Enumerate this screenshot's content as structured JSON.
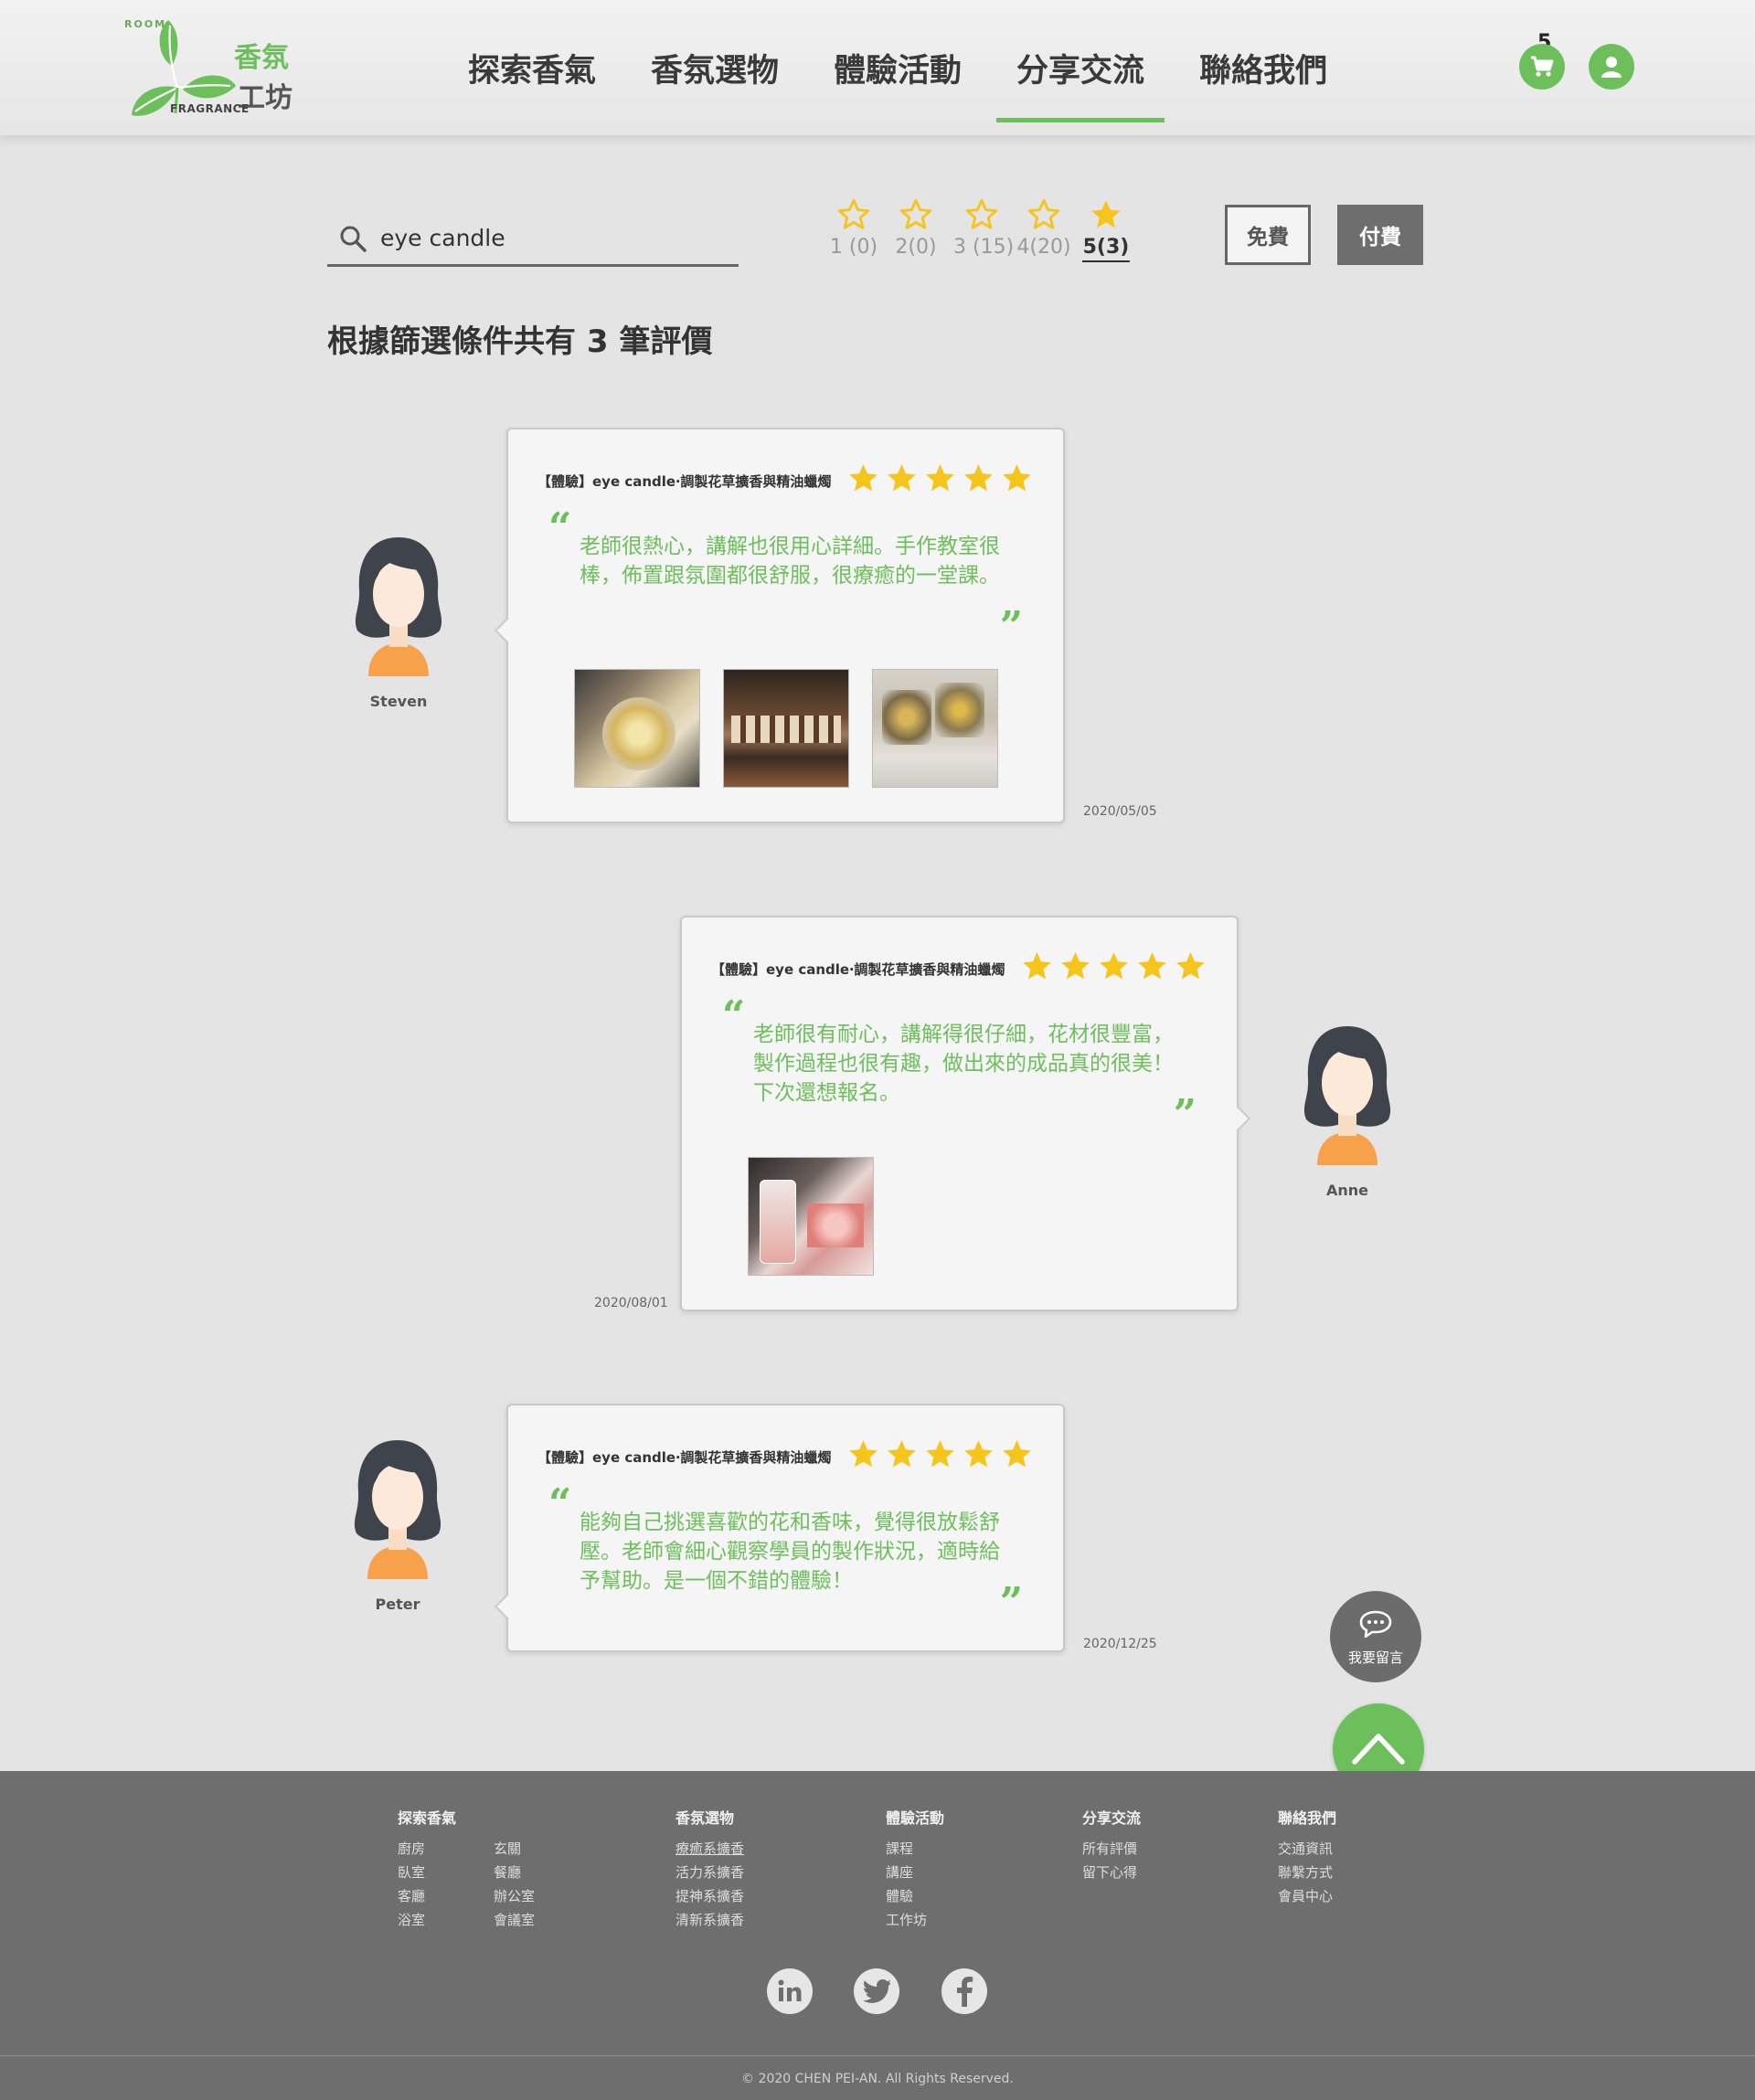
{
  "brand": {
    "room": "ROOM",
    "fragrance": "FRAGRANCE",
    "cn_line1": "香氛",
    "cn_line2": "工坊",
    "green": "#6dbf5c"
  },
  "nav": {
    "items": [
      "探索香氣",
      "香氛選物",
      "體驗活動",
      "分享交流",
      "聯絡我們"
    ],
    "active": "分享交流"
  },
  "header_icons": {
    "cart_icon": "cart-icon",
    "cart_count": "5",
    "user_icon": "user-icon"
  },
  "filter": {
    "search_icon": "search-icon",
    "search_value": "eye candle",
    "star_options": [
      {
        "label": "1 (0)",
        "filled": false
      },
      {
        "label": "2(0)",
        "filled": false
      },
      {
        "label": "3 (15)",
        "filled": false
      },
      {
        "label": "4(20)",
        "filled": false
      },
      {
        "label": "5(3)",
        "filled": true
      }
    ],
    "active_star": "5(3)",
    "free_label": "免費",
    "paid_label": "付費"
  },
  "result_summary": "根據篩選條件共有 3 筆評價",
  "reviews": [
    {
      "title": "【體驗】eye candle‧調製花草擴香與精油蠟燭",
      "rating": 5,
      "text": "老師很熱心，講解也很用心詳細。手作教室很棒，佈置跟氛圍都很舒服，很療癒的一堂課。",
      "name": "Steven",
      "date": "2020/05/05",
      "photos": 3
    },
    {
      "title": "【體驗】eye candle‧調製花草擴香與精油蠟燭",
      "rating": 5,
      "text": "老師很有耐心，講解得很仔細，花材很豐富，製作過程也很有趣，做出來的成品真的很美！下次還想報名。",
      "name": "Anne",
      "date": "2020/08/01",
      "photos": 1
    },
    {
      "title": "【體驗】eye candle‧調製花草擴香與精油蠟燭",
      "rating": 5,
      "text": "能夠自己挑選喜歡的花和香味，覺得很放鬆舒壓。老師會細心觀察學員的製作狀況，適時給予幫助。是一個不錯的體驗！",
      "name": "Peter",
      "date": "2020/12/25",
      "photos": 0
    }
  ],
  "floating": {
    "comment_label": "我要留言",
    "comment_icon": "chat-icon",
    "top_icon": "chevron-up-icon"
  },
  "footer": {
    "col1": {
      "head": "探索香氣",
      "links": [
        "廚房",
        "玄關",
        "臥室",
        "餐廳",
        "客廳",
        "辦公室",
        "浴室",
        "會議室"
      ]
    },
    "col2": {
      "head": "香氛選物",
      "links": [
        "療癒系擴香",
        "活力系擴香",
        "提神系擴香",
        "清新系擴香"
      ]
    },
    "col3": {
      "head": "體驗活動",
      "links": [
        "課程",
        "講座",
        "體驗",
        "工作坊"
      ]
    },
    "col4": {
      "head": "分享交流",
      "links": [
        "所有評價",
        "留下心得"
      ]
    },
    "col5": {
      "head": "聯絡我們",
      "links": [
        "交通資訊",
        "聯繫方式",
        "會員中心"
      ]
    },
    "social": [
      "linkedin-icon",
      "twitter-icon",
      "facebook-icon"
    ],
    "copyright": "© 2020 CHEN PEI-AN. All Rights Reserved."
  }
}
